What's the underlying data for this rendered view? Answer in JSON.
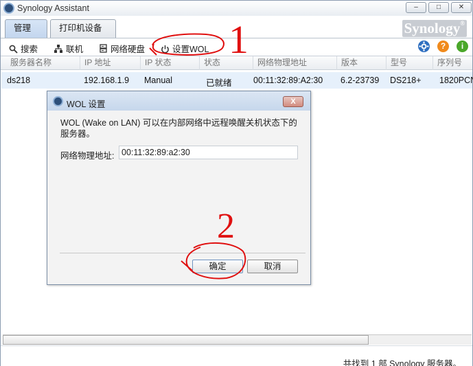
{
  "window": {
    "title": "Synology Assistant",
    "controls": [
      "–",
      "□",
      "✕"
    ]
  },
  "tabs": [
    {
      "label": "管理",
      "active": true
    },
    {
      "label": "打印机设备",
      "active": false
    }
  ],
  "brand": {
    "name": "Synology",
    "mark": "®"
  },
  "toolbar": {
    "search_label": "搜索",
    "connect_label": "联机",
    "map_drive_label": "网络硬盘",
    "wol_label": "设置WOL",
    "icons": [
      "search-icon",
      "connect-icon",
      "drive-icon",
      "power-icon",
      "gear-icon",
      "help-icon",
      "info-icon"
    ]
  },
  "table": {
    "columns": [
      "服务器名称",
      "IP 地址",
      "IP 状态",
      "状态",
      "网络物理地址",
      "版本",
      "型号",
      "序列号"
    ],
    "rows": [
      [
        "ds218",
        "192.168.1.9",
        "Manual",
        "已就绪",
        "00:11:32:89:A2:30",
        "6.2-23739",
        "DS218+",
        "1820PCN"
      ]
    ]
  },
  "status": {
    "text": "共找到 1 部 Synology 服务器。"
  },
  "dialog": {
    "title": "WOL 设置",
    "close": "X",
    "description": "WOL (Wake on LAN) 可以在内部网络中远程唤醒关机状态下的服务器。",
    "mac_label": "网络物理地址:",
    "mac_value": "00:11:32:89:a2:30",
    "ok_label": "确定",
    "cancel_label": "取消"
  },
  "annotations": {
    "step1": "1",
    "step2": "2",
    "color": "#e01010"
  },
  "colors": {
    "selected_row": "#e6f0fb",
    "dialog_title": "#c6d7ec",
    "close_button": "#d28b7f"
  }
}
